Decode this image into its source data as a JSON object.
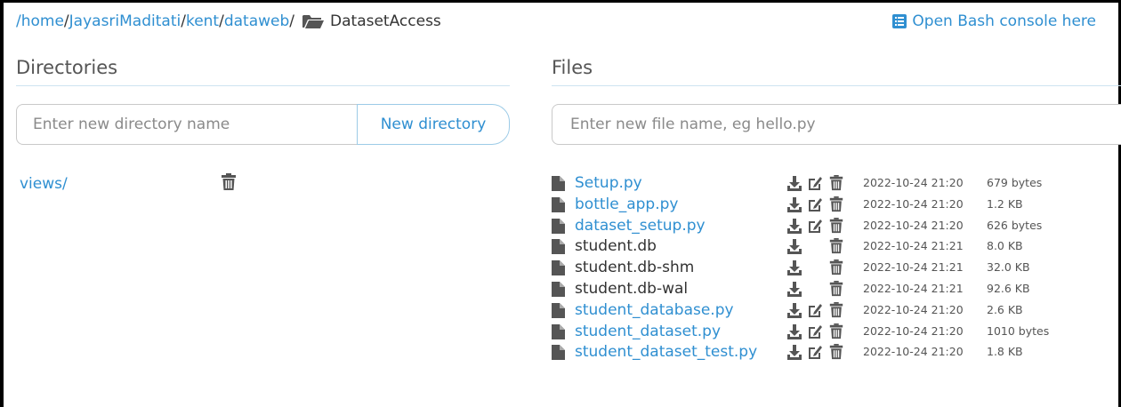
{
  "breadcrumb": {
    "parts": [
      {
        "label": "/home"
      },
      {
        "label": "/"
      },
      {
        "label": "JayasriMaditati"
      },
      {
        "label": "/"
      },
      {
        "label": "kent"
      },
      {
        "label": "/"
      },
      {
        "label": "dataweb"
      },
      {
        "label": "/"
      }
    ],
    "current": "DatasetAccess",
    "current_icon": "folder-open-icon"
  },
  "bash_console": {
    "label": "Open Bash console here",
    "icon": "console-icon"
  },
  "directories": {
    "title": "Directories",
    "input_placeholder": "Enter new directory name",
    "button_label": "New directory",
    "items": [
      {
        "name": "views/",
        "icon": "trash-icon"
      }
    ]
  },
  "files": {
    "title": "Files",
    "input_placeholder": "Enter new file name, eg hello.py",
    "items": [
      {
        "name": "Setup.py",
        "editable": true,
        "date": "2022-10-24 21:20",
        "size": "679 bytes"
      },
      {
        "name": "bottle_app.py",
        "editable": true,
        "date": "2022-10-24 21:20",
        "size": "1.2 KB"
      },
      {
        "name": "dataset_setup.py",
        "editable": true,
        "date": "2022-10-24 21:20",
        "size": "626 bytes"
      },
      {
        "name": "student.db",
        "editable": false,
        "date": "2022-10-24 21:21",
        "size": "8.0 KB"
      },
      {
        "name": "student.db-shm",
        "editable": false,
        "date": "2022-10-24 21:21",
        "size": "32.0 KB"
      },
      {
        "name": "student.db-wal",
        "editable": false,
        "date": "2022-10-24 21:21",
        "size": "92.6 KB"
      },
      {
        "name": "student_database.py",
        "editable": true,
        "date": "2022-10-24 21:20",
        "size": "2.6 KB"
      },
      {
        "name": "student_dataset.py",
        "editable": true,
        "date": "2022-10-24 21:20",
        "size": "1010 bytes"
      },
      {
        "name": "student_dataset_test.py",
        "editable": true,
        "date": "2022-10-24 21:20",
        "size": "1.8 KB"
      }
    ]
  },
  "colors": {
    "link": "#2f8fd1",
    "text": "#333333",
    "rule": "#cde4f0"
  }
}
